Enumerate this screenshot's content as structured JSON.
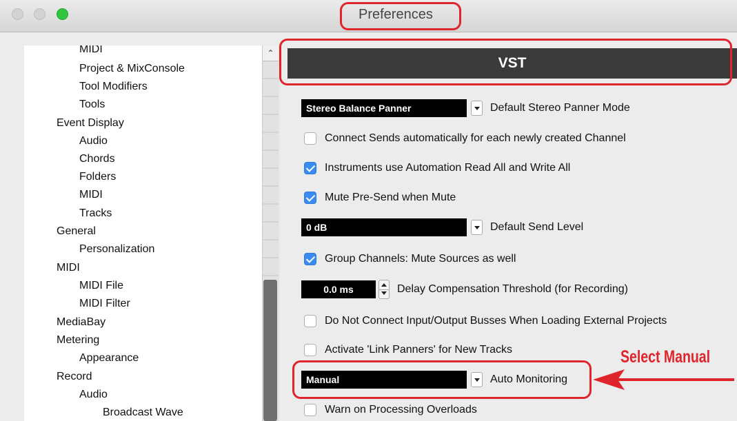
{
  "window": {
    "title": "Preferences"
  },
  "sidebar": {
    "items": [
      {
        "label": "MIDI",
        "level": 1
      },
      {
        "label": "Project & MixConsole",
        "level": 1
      },
      {
        "label": "Tool Modifiers",
        "level": 1
      },
      {
        "label": "Tools",
        "level": 1
      },
      {
        "label": "Event Display",
        "level": 0
      },
      {
        "label": "Audio",
        "level": 1
      },
      {
        "label": "Chords",
        "level": 1
      },
      {
        "label": "Folders",
        "level": 1
      },
      {
        "label": "MIDI",
        "level": 1
      },
      {
        "label": "Tracks",
        "level": 1
      },
      {
        "label": "General",
        "level": 0
      },
      {
        "label": "Personalization",
        "level": 1
      },
      {
        "label": "MIDI",
        "level": 0
      },
      {
        "label": "MIDI File",
        "level": 1
      },
      {
        "label": "MIDI Filter",
        "level": 1
      },
      {
        "label": "MediaBay",
        "level": 0
      },
      {
        "label": "Metering",
        "level": 0
      },
      {
        "label": "Appearance",
        "level": 1
      },
      {
        "label": "Record",
        "level": 0
      },
      {
        "label": "Audio",
        "level": 1
      },
      {
        "label": "Broadcast Wave",
        "level": 2
      }
    ]
  },
  "panel": {
    "title": "VST",
    "stereo_panner": {
      "value": "Stereo Balance Panner",
      "label": "Default Stereo Panner Mode"
    },
    "connect_sends": {
      "checked": false,
      "label": "Connect Sends automatically for each newly created Channel"
    },
    "instruments_automation": {
      "checked": true,
      "label": "Instruments use Automation Read All and Write All"
    },
    "mute_pre_send": {
      "checked": true,
      "label": "Mute Pre-Send when Mute"
    },
    "send_level": {
      "value": "0 dB",
      "label": "Default Send Level"
    },
    "group_channels": {
      "checked": true,
      "label": "Group Channels: Mute Sources as well"
    },
    "delay_comp": {
      "value": "0.0 ms",
      "label": "Delay Compensation Threshold (for Recording)"
    },
    "no_connect_busses": {
      "checked": false,
      "label": "Do Not Connect Input/Output Busses When Loading External Projects"
    },
    "link_panners": {
      "checked": false,
      "label": "Activate 'Link Panners' for New Tracks"
    },
    "auto_monitoring": {
      "value": "Manual",
      "label": "Auto Monitoring"
    },
    "warn_overloads": {
      "checked": false,
      "label": "Warn on Processing Overloads"
    }
  },
  "annotation": {
    "text": "Select Manual",
    "color": "#e0242b"
  }
}
